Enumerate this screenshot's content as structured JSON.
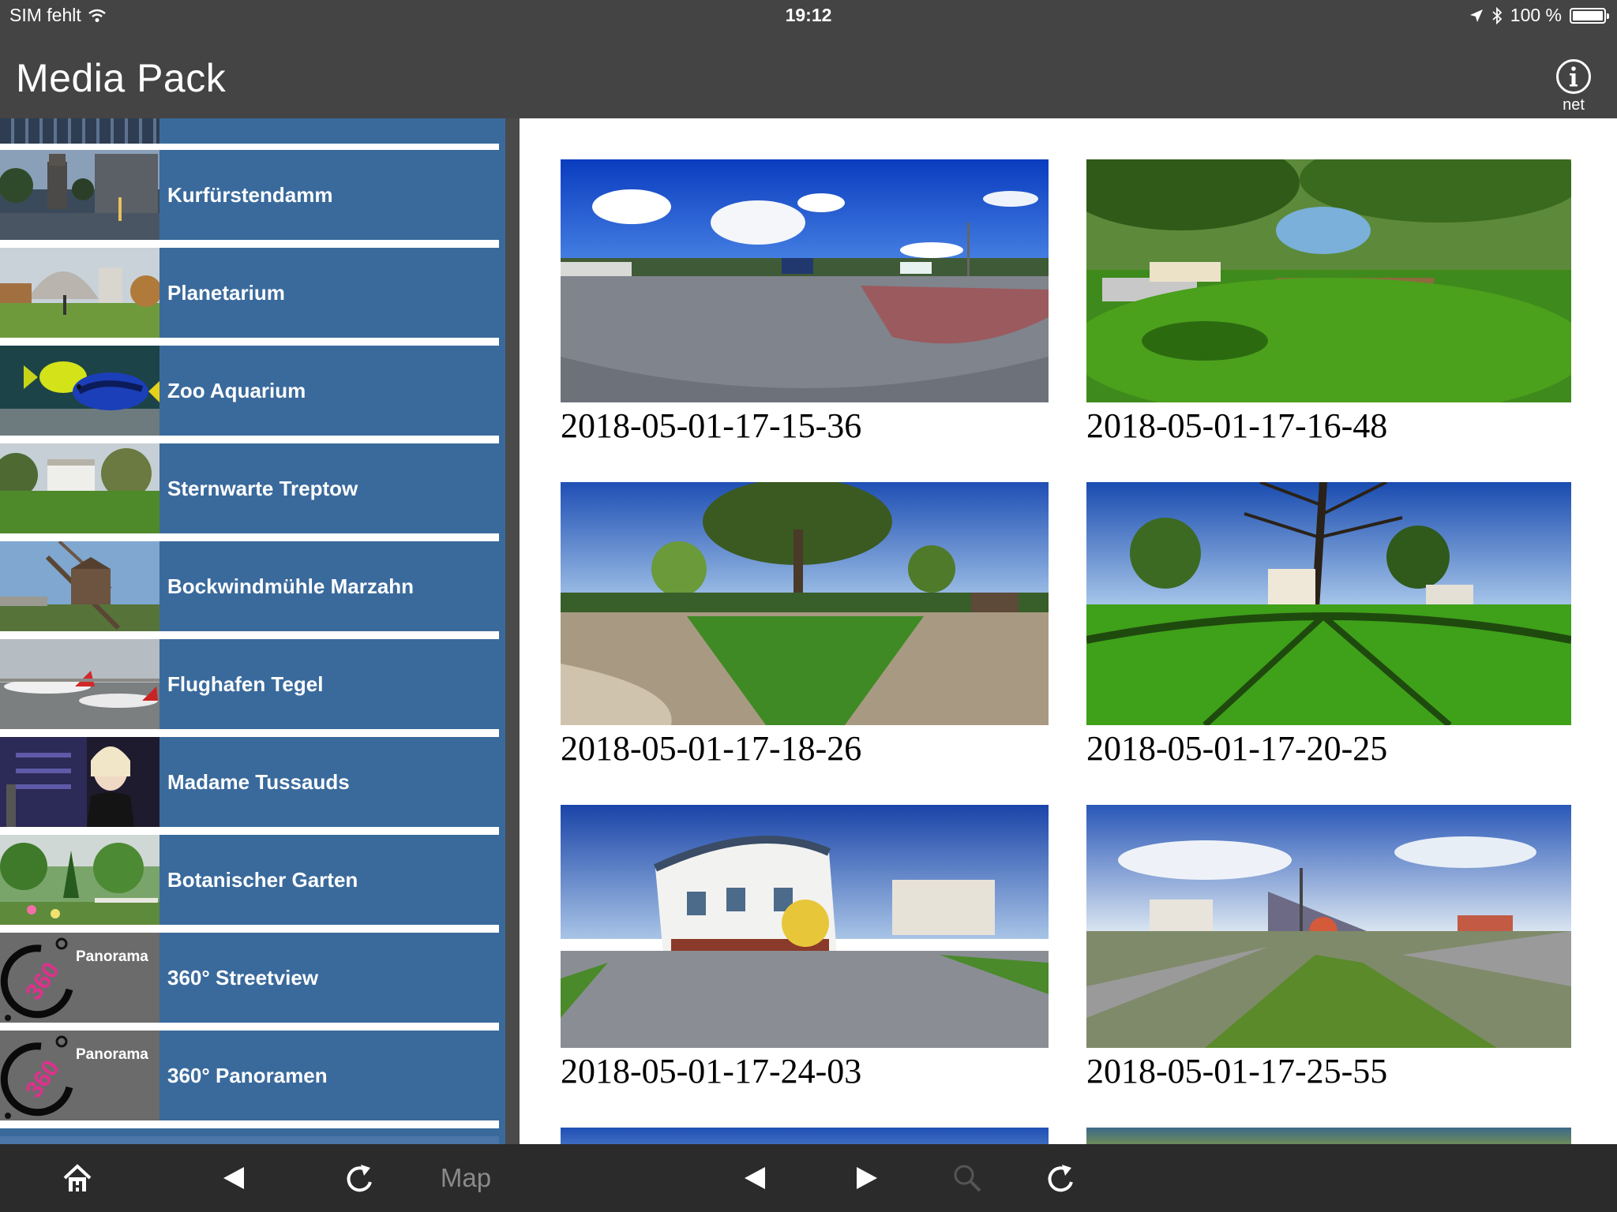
{
  "status_bar": {
    "carrier": "SIM fehlt",
    "time": "19:12",
    "battery": "100 %",
    "battery_level": 1.0,
    "wifi_icon": "wifi-icon",
    "location_icon": "location-arrow-icon",
    "bluetooth_icon": "bluetooth-icon"
  },
  "header": {
    "title": "Media Pack",
    "info_icon": "info-icon",
    "info_label": "net"
  },
  "sidebar": {
    "items": [
      {
        "label": "Kurfürstendamm",
        "thumb": "street"
      },
      {
        "label": "Planetarium",
        "thumb": "planetarium"
      },
      {
        "label": "Zoo Aquarium",
        "thumb": "fish"
      },
      {
        "label": "Sternwarte Treptow",
        "thumb": "lawn"
      },
      {
        "label": "Bockwindmühle Marzahn",
        "thumb": "windmill"
      },
      {
        "label": "Flughafen Tegel",
        "thumb": "airport"
      },
      {
        "label": "Madame Tussauds",
        "thumb": "wax"
      },
      {
        "label": "Botanischer Garten",
        "thumb": "garden"
      },
      {
        "label": "360° Streetview",
        "thumb": "logo360",
        "logo_word": "Panorama",
        "logo_digits": "360"
      },
      {
        "label": "360° Panoramen",
        "thumb": "logo360",
        "logo_word": "Panorama",
        "logo_digits": "360"
      }
    ]
  },
  "gallery": {
    "items": [
      {
        "caption": "2018-05-01-17-15-36",
        "scene": "parking"
      },
      {
        "caption": "2018-05-01-17-16-48",
        "scene": "park"
      },
      {
        "caption": "2018-05-01-17-18-26",
        "scene": "path-trees"
      },
      {
        "caption": "2018-05-01-17-20-25",
        "scene": "meadow-tree"
      },
      {
        "caption": "2018-05-01-17-24-03",
        "scene": "building"
      },
      {
        "caption": "2018-05-01-17-25-55",
        "scene": "street-graffiti"
      }
    ]
  },
  "toolbar": {
    "home_icon": "home-icon",
    "back_icon": "back-triangle-icon",
    "reload_icon": "reload-icon",
    "map_label": "Map",
    "prev_icon": "previous-triangle-icon",
    "next_icon": "next-triangle-icon",
    "search_icon": "search-icon",
    "refresh_icon": "refresh-icon"
  }
}
